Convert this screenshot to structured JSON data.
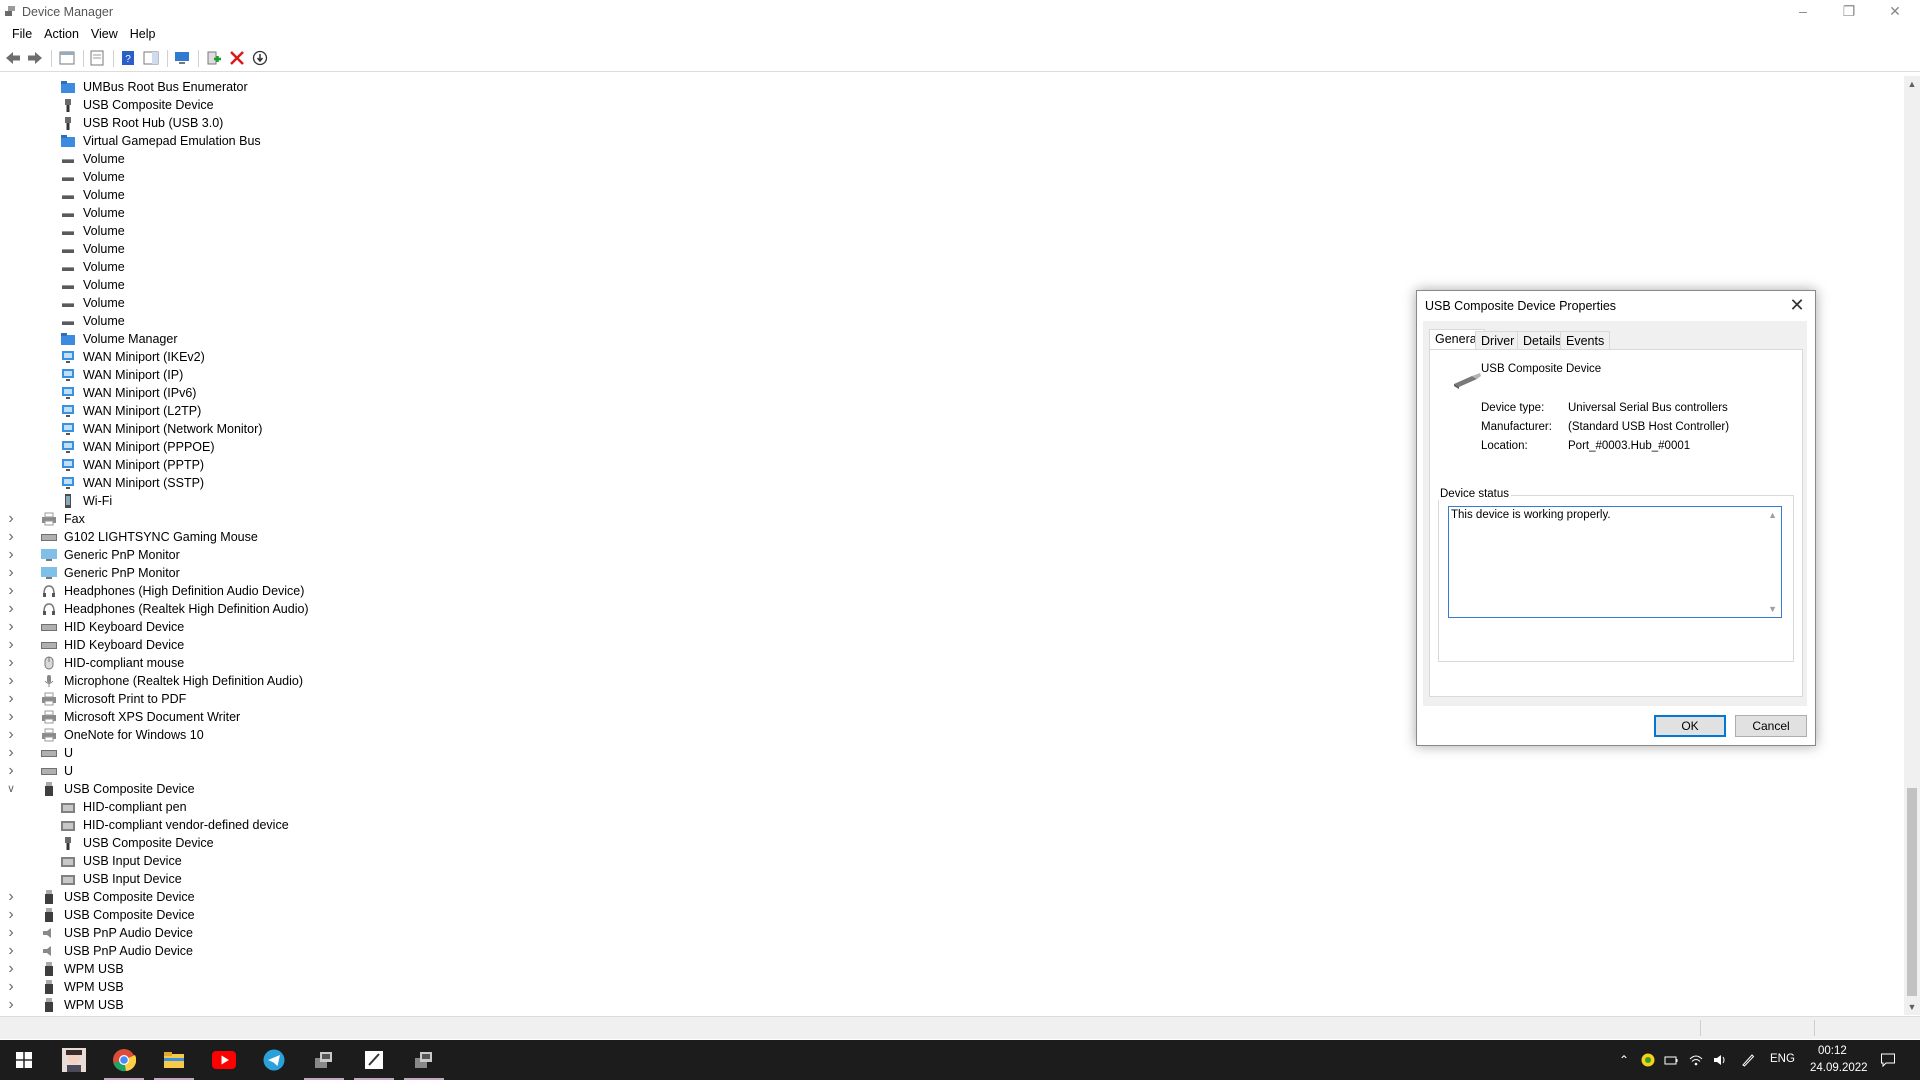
{
  "window": {
    "title": "Device Manager"
  },
  "menu": [
    "File",
    "Action",
    "View",
    "Help"
  ],
  "tree": [
    {
      "label": "UMBus Root Bus Enumerator",
      "level": 2,
      "icon": "sysfolder-icon"
    },
    {
      "label": "USB Composite Device",
      "level": 2,
      "icon": "usb-plug-icon"
    },
    {
      "label": "USB Root Hub (USB 3.0)",
      "level": 2,
      "icon": "usb-plug-icon"
    },
    {
      "label": "Virtual Gamepad Emulation Bus",
      "level": 2,
      "icon": "sysfolder-icon"
    },
    {
      "label": "Volume",
      "level": 2,
      "icon": "volume-icon"
    },
    {
      "label": "Volume",
      "level": 2,
      "icon": "volume-icon"
    },
    {
      "label": "Volume",
      "level": 2,
      "icon": "volume-icon"
    },
    {
      "label": "Volume",
      "level": 2,
      "icon": "volume-icon"
    },
    {
      "label": "Volume",
      "level": 2,
      "icon": "volume-icon"
    },
    {
      "label": "Volume",
      "level": 2,
      "icon": "volume-icon"
    },
    {
      "label": "Volume",
      "level": 2,
      "icon": "volume-icon"
    },
    {
      "label": "Volume",
      "level": 2,
      "icon": "volume-icon"
    },
    {
      "label": "Volume",
      "level": 2,
      "icon": "volume-icon"
    },
    {
      "label": "Volume",
      "level": 2,
      "icon": "volume-icon"
    },
    {
      "label": "Volume Manager",
      "level": 2,
      "icon": "sysfolder-icon"
    },
    {
      "label": "WAN Miniport (IKEv2)",
      "level": 2,
      "icon": "network-adapter-icon"
    },
    {
      "label": "WAN Miniport (IP)",
      "level": 2,
      "icon": "network-adapter-icon"
    },
    {
      "label": "WAN Miniport (IPv6)",
      "level": 2,
      "icon": "network-adapter-icon"
    },
    {
      "label": "WAN Miniport (L2TP)",
      "level": 2,
      "icon": "network-adapter-icon"
    },
    {
      "label": "WAN Miniport (Network Monitor)",
      "level": 2,
      "icon": "network-adapter-icon"
    },
    {
      "label": "WAN Miniport (PPPOE)",
      "level": 2,
      "icon": "network-adapter-icon"
    },
    {
      "label": "WAN Miniport (PPTP)",
      "level": 2,
      "icon": "network-adapter-icon"
    },
    {
      "label": "WAN Miniport (SSTP)",
      "level": 2,
      "icon": "network-adapter-icon"
    },
    {
      "label": "Wi-Fi",
      "level": 2,
      "icon": "phone-icon"
    },
    {
      "label": "Fax",
      "level": 1,
      "icon": "printer-icon",
      "expander": "collapsed"
    },
    {
      "label": "G102 LIGHTSYNC Gaming Mouse",
      "level": 1,
      "icon": "keyboard-icon",
      "expander": "collapsed"
    },
    {
      "label": "Generic PnP Monitor",
      "level": 1,
      "icon": "monitor-icon",
      "expander": "collapsed"
    },
    {
      "label": "Generic PnP Monitor",
      "level": 1,
      "icon": "monitor-icon",
      "expander": "collapsed"
    },
    {
      "label": "Headphones (High Definition Audio Device)",
      "level": 1,
      "icon": "headphones-icon",
      "expander": "collapsed"
    },
    {
      "label": "Headphones (Realtek High Definition Audio)",
      "level": 1,
      "icon": "headphones-icon",
      "expander": "collapsed"
    },
    {
      "label": "HID Keyboard Device",
      "level": 1,
      "icon": "keyboard-icon",
      "expander": "collapsed"
    },
    {
      "label": "HID Keyboard Device",
      "level": 1,
      "icon": "keyboard-icon",
      "expander": "collapsed"
    },
    {
      "label": "HID-compliant mouse",
      "level": 1,
      "icon": "mouse-icon",
      "expander": "collapsed"
    },
    {
      "label": "Microphone (Realtek High Definition Audio)",
      "level": 1,
      "icon": "microphone-icon",
      "expander": "collapsed"
    },
    {
      "label": "Microsoft Print to PDF",
      "level": 1,
      "icon": "printer-icon",
      "expander": "collapsed"
    },
    {
      "label": "Microsoft XPS Document Writer",
      "level": 1,
      "icon": "printer-icon",
      "expander": "collapsed"
    },
    {
      "label": "OneNote for Windows 10",
      "level": 1,
      "icon": "printer-icon",
      "expander": "collapsed"
    },
    {
      "label": "U",
      "level": 1,
      "icon": "keyboard-icon",
      "expander": "collapsed"
    },
    {
      "label": "U",
      "level": 1,
      "icon": "keyboard-icon",
      "expander": "collapsed"
    },
    {
      "label": "USB Composite Device",
      "level": 1,
      "icon": "usb-drive-icon",
      "expander": "expanded"
    },
    {
      "label": "HID-compliant pen",
      "level": 2,
      "icon": "hid-icon"
    },
    {
      "label": "HID-compliant vendor-defined device",
      "level": 2,
      "icon": "hid-icon"
    },
    {
      "label": "USB Composite Device",
      "level": 2,
      "icon": "usb-plug-icon"
    },
    {
      "label": "USB Input Device",
      "level": 2,
      "icon": "hid-icon"
    },
    {
      "label": "USB Input Device",
      "level": 2,
      "icon": "hid-icon"
    },
    {
      "label": "USB Composite Device",
      "level": 1,
      "icon": "usb-drive-icon",
      "expander": "collapsed"
    },
    {
      "label": "USB Composite Device",
      "level": 1,
      "icon": "usb-drive-icon",
      "expander": "collapsed"
    },
    {
      "label": "USB PnP Audio Device",
      "level": 1,
      "icon": "speaker-icon",
      "expander": "collapsed"
    },
    {
      "label": "USB PnP Audio Device",
      "level": 1,
      "icon": "speaker-icon",
      "expander": "collapsed"
    },
    {
      "label": "WPM USB",
      "level": 1,
      "icon": "usb-drive-icon",
      "expander": "collapsed"
    },
    {
      "label": "WPM USB",
      "level": 1,
      "icon": "usb-drive-icon",
      "expander": "collapsed"
    },
    {
      "label": "WPM USB",
      "level": 1,
      "icon": "usb-drive-icon",
      "expander": "collapsed"
    }
  ],
  "dialog": {
    "title": "USB Composite Device Properties",
    "tabs": [
      "General",
      "Driver",
      "Details",
      "Events"
    ],
    "active_tab": "General",
    "device_name": "USB Composite Device",
    "props": [
      {
        "key": "Device type:",
        "value": "Universal Serial Bus controllers"
      },
      {
        "key": "Manufacturer:",
        "value": "(Standard USB Host Controller)"
      },
      {
        "key": "Location:",
        "value": "Port_#0003.Hub_#0001"
      }
    ],
    "status_legend": "Device status",
    "status_text": "This device is working properly.",
    "ok_label": "OK",
    "cancel_label": "Cancel"
  },
  "taskbar": {
    "lang": "ENG",
    "time": "00:12",
    "date": "24.09.2022"
  },
  "colors": {
    "accent": "#0078d7",
    "taskbar": "#1c1c1c"
  }
}
